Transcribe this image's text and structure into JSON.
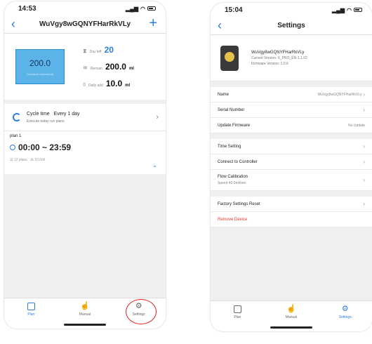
{
  "phone1": {
    "status_time": "14:53",
    "nav_title": "WuVgy8wGQNYFHarRkVLy",
    "volume": "200.0",
    "volume_label": "Container volume(ml)",
    "day_left_label": "Day left",
    "day_left_value": "20",
    "remain_label": "Remain",
    "remain_value": "200.0",
    "remain_unit": "ml",
    "daily_add_label": "Daily add",
    "daily_add_value": "10.0",
    "daily_add_unit": "ml",
    "cycle_title": "Cycle time",
    "cycle_value": "Every 1 day",
    "cycle_sub": "Execute today run plans",
    "plan_name": "plan 1",
    "plan_time": "00:00 ~ 23:59",
    "plan_count": "12 plans",
    "plan_amount": "10.0ml",
    "tabs": [
      "Plan",
      "Manual",
      "Settings"
    ]
  },
  "phone2": {
    "status_time": "15:04",
    "nav_title": "Settings",
    "device_name": "WuVgy8wGQNYFHarRkVLy",
    "current_version": "Current Version:  X_PRO_EN-1.1.02",
    "firmware_version": "Firmware Version:  1.0.6",
    "rows": {
      "name_label": "Name",
      "name_value": "WuVgy8wGQNYFHarRkVLy",
      "serial_label": "Serial Number",
      "update_label": "Update Firmware",
      "update_value": "No Update",
      "time_label": "Time Setting",
      "connect_label": "Connect to Controller",
      "flow_label": "Flow Calibration",
      "flow_sub": "Speed:40.0ml/min",
      "reset_label": "Factory Settings Reset",
      "remove_label": "Remove Device"
    },
    "tabs": [
      "Plan",
      "Manual",
      "Settings"
    ]
  },
  "colors": {
    "accent": "#2a7de1",
    "highlight": "#e02222",
    "danger": "#e0342a",
    "tank": "#5cb3e8"
  }
}
